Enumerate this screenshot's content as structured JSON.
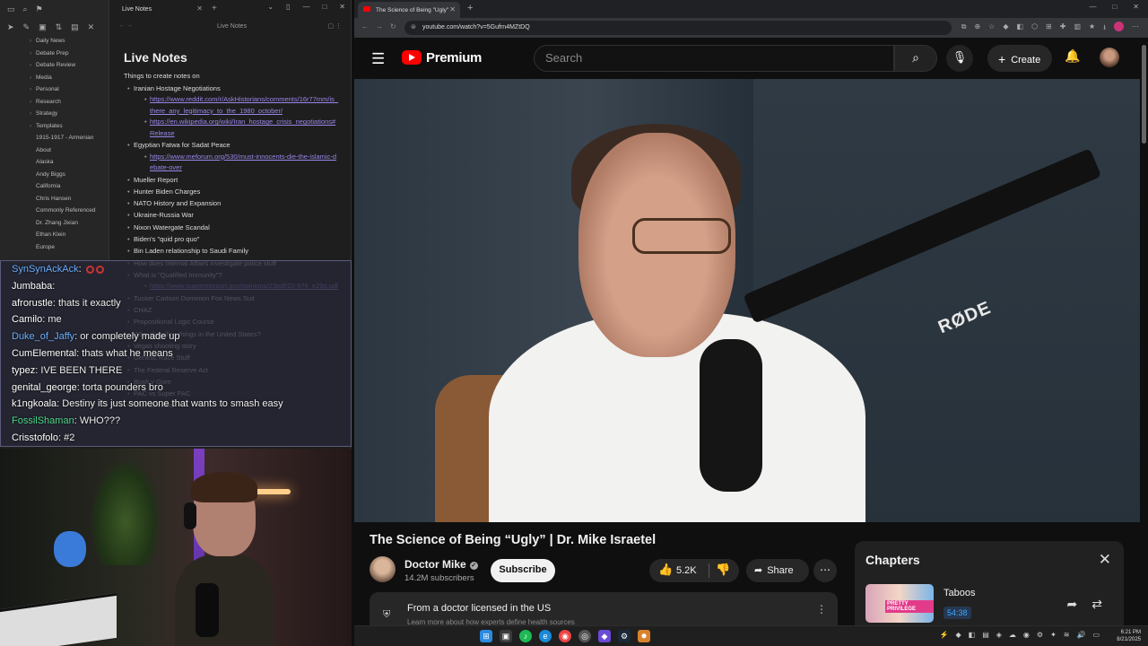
{
  "obsidian": {
    "tab_title": "Live Notes",
    "view_title": "Live Notes",
    "note_title": "Live Notes",
    "intro": "Things to create notes on",
    "tree": [
      "Daily News",
      "Debate Prep",
      "Debate Review",
      "Media",
      "Personal",
      "Research",
      "Strategy",
      "Templates",
      "1915-1917 - Armenian",
      "About",
      "Alaska",
      "Andy Biggs",
      "California",
      "Chris Hansen",
      "Commonly Referenced",
      "Dr. Zhang Jixian",
      "Ethan Klein",
      "Europe"
    ],
    "items": [
      {
        "text": "Iranian Hostage Negotiations",
        "level": 1
      },
      {
        "text": "https://www.reddit.com/r/AskHistorians/comments/16r77mm/is_there_any_legitimacy_to_the_1980_october/",
        "level": 2,
        "link": true
      },
      {
        "text": "https://en.wikipedia.org/wiki/Iran_hostage_crisis_negotiations#Release",
        "level": 2,
        "link": true
      },
      {
        "text": "Egyptian Fatwa for Sadat Peace",
        "level": 1
      },
      {
        "text": "https://www.meforum.org/530/must-innocents-die-the-islamic-debate-over",
        "level": 2,
        "link": true
      },
      {
        "text": "Mueller Report",
        "level": 1
      },
      {
        "text": "Hunter Biden Charges",
        "level": 1
      },
      {
        "text": "NATO History and Expansion",
        "level": 1
      },
      {
        "text": "Ukraine-Russia War",
        "level": 1
      },
      {
        "text": "Nixon Watergate Scandal",
        "level": 1
      },
      {
        "text": "Biden's \"quid pro quo\"",
        "level": 1
      },
      {
        "text": "Bin Laden relationship to Saudi Family",
        "level": 1
      },
      {
        "text": "How does Internal Affairs investigate police stuff",
        "level": 1
      },
      {
        "text": "What is \"Qualified Immunity\"?",
        "level": 1
      },
      {
        "text": "https://www.supremecourt.gov/opinions/23pdf/22-976_e29g.pdf",
        "level": 2,
        "link": true
      },
      {
        "text": "Tucker Carlson Dominion Fox News Suit",
        "level": 1
      },
      {
        "text": "CHAZ",
        "level": 1
      },
      {
        "text": "Propositional Logic Course",
        "level": 1
      },
      {
        "text": "Who classifies things in the United States?",
        "level": 1
      },
      {
        "text": "Vegas shooting story",
        "level": 1
      },
      {
        "text": "Genetic Race Stuff",
        "level": 1
      },
      {
        "text": "The Federal Reserve Act",
        "level": 1
      },
      {
        "text": "Bush v Gore",
        "level": 1,
        "italic": true
      },
      {
        "text": "PAC vs Super PAC",
        "level": 1
      },
      {
        "text": "Che Guevara",
        "level": 1
      }
    ]
  },
  "chat": [
    {
      "user": "SynSynAckAck",
      "msg": "",
      "color": "#6ab0ff",
      "emote": true
    },
    {
      "user": "Jumbaba",
      "msg": "",
      "color": "#ffffff"
    },
    {
      "user": "afrorustle",
      "msg": "thats it exactly",
      "color": "#ffffff"
    },
    {
      "user": "Camilo",
      "msg": "me",
      "color": "#ffffff"
    },
    {
      "user": "Duke_of_Jaffy",
      "msg": "or completely made up",
      "color": "#6ab0ff"
    },
    {
      "user": "CumElemental",
      "msg": "thats what he means",
      "color": "#ffffff"
    },
    {
      "user": "typez",
      "msg": "IVE BEEN THERE",
      "color": "#ffffff"
    },
    {
      "user": "genital_george",
      "msg": "torta pounders bro",
      "color": "#ffffff"
    },
    {
      "user": "k1ngkoala",
      "msg": "Destiny its just someone that wants to smash easy",
      "color": "#ffffff"
    },
    {
      "user": "FossilShaman",
      "msg": "WHO???",
      "color": "#4bd98a"
    },
    {
      "user": "Crisstofolo",
      "msg": "#2",
      "color": "#ffffff"
    }
  ],
  "browser": {
    "tab_title": "The Science of Being \"Ugly\"",
    "url": "youtube.com/watch?v=5Gufrn4MZtDQ"
  },
  "youtube": {
    "brand": "Premium",
    "search_placeholder": "Search",
    "create_label": "Create",
    "video_title": "The Science of Being “Ugly” | Dr. Mike Israetel",
    "channel_name": "Doctor Mike",
    "subscribers": "14.2M subscribers",
    "subscribe_label": "Subscribe",
    "likes": "5.2K",
    "share_label": "Share",
    "info_text": "From a doctor licensed in the US",
    "info_sub": "Learn more about how experts define health sources",
    "chapters_title": "Chapters",
    "chapter_name": "Taboos",
    "chapter_time": "54:38",
    "chapter_thumb_tag": "PRETTY PRIVILEGE",
    "mic_brand": "RØDE"
  },
  "taskbar": {
    "time": "6:21 PM",
    "date": "8/21/2025"
  }
}
